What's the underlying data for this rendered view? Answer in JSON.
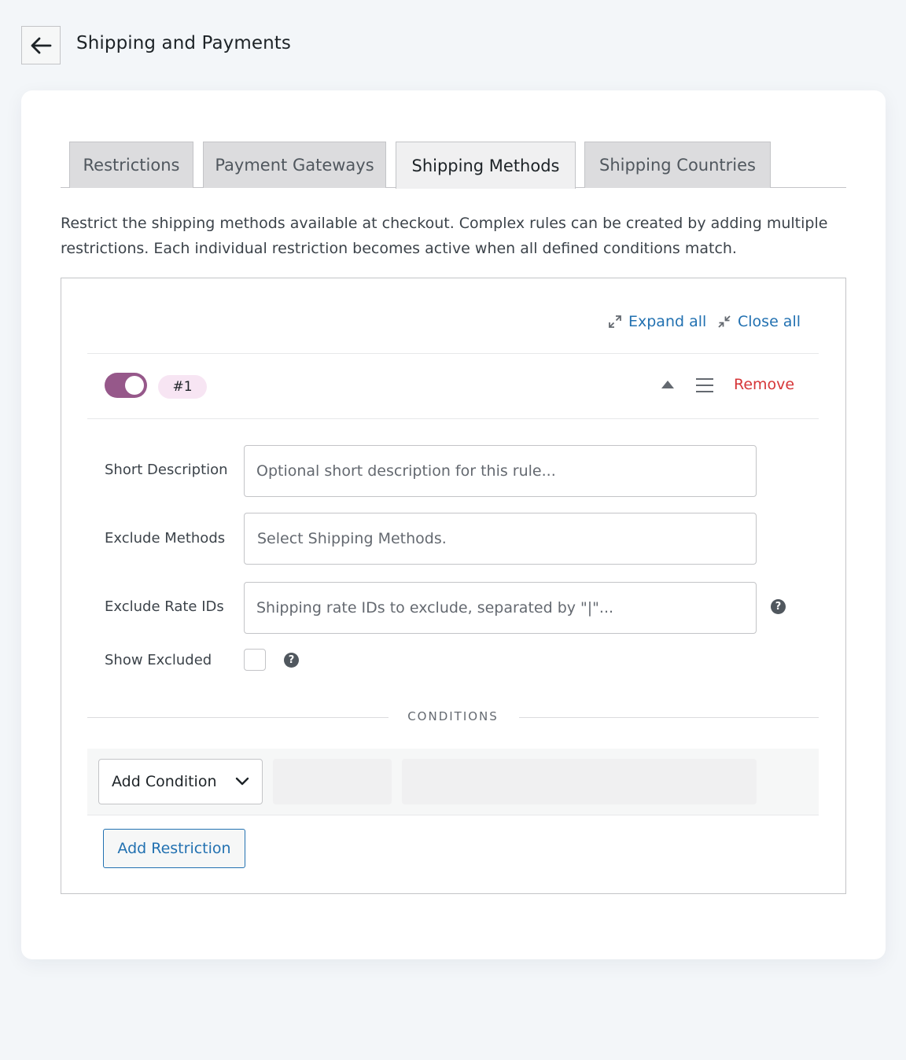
{
  "header": {
    "back_icon": "arrow-left-icon",
    "title": "Shipping and Payments"
  },
  "tabs": [
    {
      "label": "Restrictions",
      "active": false
    },
    {
      "label": "Payment Gateways",
      "active": false
    },
    {
      "label": "Shipping Methods",
      "active": true
    },
    {
      "label": "Shipping Countries",
      "active": false
    }
  ],
  "description": "Restrict the shipping methods available at checkout. Complex rules can be created by adding multiple restrictions. Each individual restriction becomes active when all defined conditions match.",
  "panel": {
    "expand_all": "Expand all",
    "close_all": "Close all",
    "restriction": {
      "enabled": true,
      "badge": "#1",
      "remove_label": "Remove",
      "fields": {
        "short_description": {
          "label": "Short Description",
          "placeholder": "Optional short description for this rule...",
          "value": ""
        },
        "exclude_methods": {
          "label": "Exclude Methods",
          "placeholder": "Select Shipping Methods."
        },
        "exclude_rate_ids": {
          "label": "Exclude Rate IDs",
          "placeholder": "Shipping rate IDs to exclude, separated by \"|\"...",
          "value": ""
        },
        "show_excluded": {
          "label": "Show Excluded",
          "checked": false
        }
      },
      "conditions": {
        "heading": "CONDITIONS",
        "add_condition_label": "Add Condition"
      }
    },
    "add_restriction_label": "Add Restriction"
  },
  "colors": {
    "accent": "#96588a",
    "badge_bg": "#f7e5f3",
    "link": "#2271b1",
    "danger": "#d63638"
  },
  "help_glyph": "?"
}
